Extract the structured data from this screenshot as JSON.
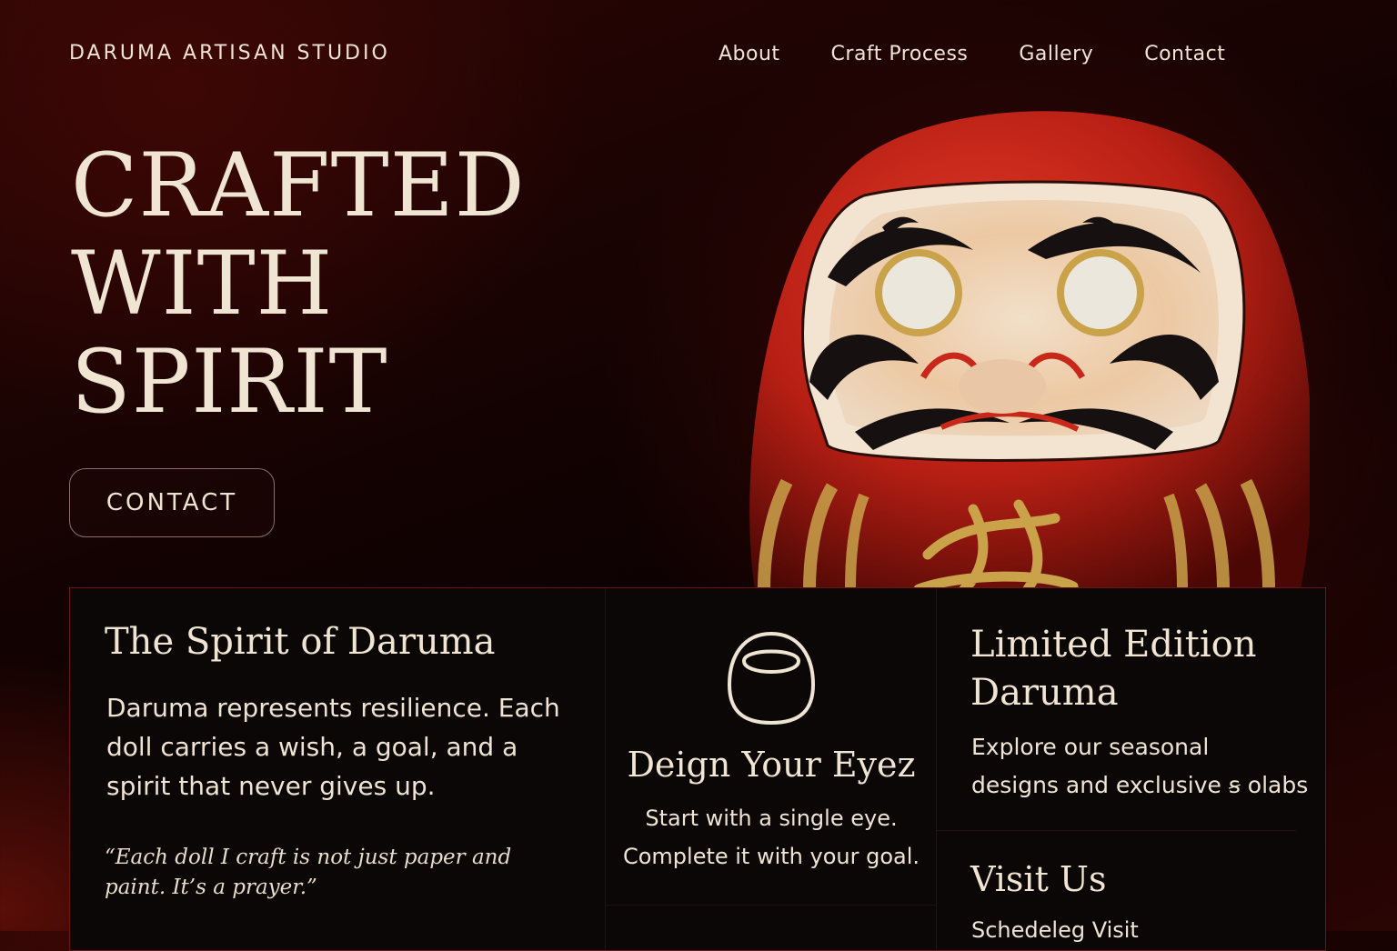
{
  "header": {
    "brand": "DARUMA ARTISAN STUDIO",
    "nav": [
      {
        "label": "About"
      },
      {
        "label": "Craft Process"
      },
      {
        "label": "Gallery"
      },
      {
        "label": "Contact"
      }
    ]
  },
  "hero": {
    "title_lines": [
      "CRAFTED",
      "WITH",
      "SPIRIT"
    ],
    "cta_label": "CONTACT",
    "image": "red-daruma-doll"
  },
  "panel": {
    "spirit": {
      "title": "The Spirit of Daruma",
      "body": "Daruma represents resilience. Each doll carries a wish, a goal, and a spirit that never gives up.",
      "quote": "“Each doll I craft is not just paper and paint. It’s a prayer.”"
    },
    "eyes": {
      "icon": "daruma-outline-icon",
      "title": "Deign Your Eyez",
      "body_lines": [
        "Start with a single eye.",
        "Complete it with your goal."
      ]
    },
    "limited": {
      "title_lines": [
        "Limited Edition",
        "Daruma"
      ],
      "body_lines": [
        "Explore our seasonal",
        "designs and exclusive  ꞩ olabs"
      ]
    },
    "visit": {
      "title": "Visit Us",
      "link": "Schedeleg Visit"
    }
  },
  "colors": {
    "background": "#120202",
    "text": "#efe4d4",
    "accent_red": "#c8281a",
    "gold": "#c9a24a",
    "panel_bg": "#0b0706",
    "panel_border": "#6b1410"
  }
}
